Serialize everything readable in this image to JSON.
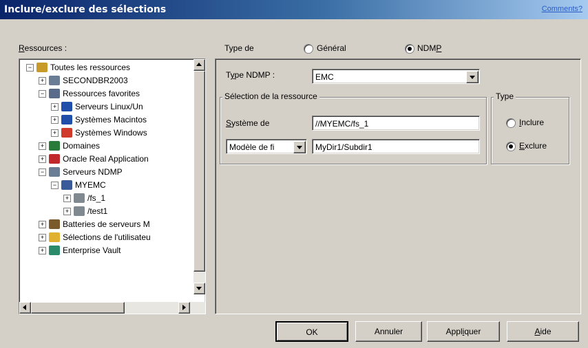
{
  "window": {
    "title": "Inclure/exclure des sélections",
    "comments_link": "Comments?"
  },
  "resources": {
    "label_first": "R",
    "label_rest": "essources :",
    "tree": [
      {
        "label": "Toutes les ressources",
        "icon": "all-resources-icon",
        "expander": "−"
      },
      {
        "label": "SECONDBR2003",
        "icon": "server-icon",
        "expander": "+"
      },
      {
        "label": "Ressources favorites",
        "icon": "favorite-resources-icon",
        "expander": "−"
      },
      {
        "label": "Serveurs Linux/Un",
        "icon": "monitor-icon",
        "expander": "+"
      },
      {
        "label": "Systèmes Macintos",
        "icon": "monitor-icon",
        "expander": "+"
      },
      {
        "label": "Systèmes Windows",
        "icon": "windows-icon",
        "expander": "+"
      },
      {
        "label": "Domaines",
        "icon": "domain-icon",
        "expander": "+"
      },
      {
        "label": "Oracle Real Application",
        "icon": "database-icon",
        "expander": "+"
      },
      {
        "label": "Serveurs NDMP",
        "icon": "server-icon",
        "expander": "−"
      },
      {
        "label": "MYEMC",
        "icon": "tower-icon",
        "expander": "−"
      },
      {
        "label": "/fs_1",
        "icon": "drive-icon",
        "expander": "+"
      },
      {
        "label": "/test1",
        "icon": "drive-icon",
        "expander": "+"
      },
      {
        "label": "Batteries de serveurs M",
        "icon": "server-farm-icon",
        "expander": "+"
      },
      {
        "label": "Sélections de l'utilisateu",
        "icon": "folder-icon",
        "expander": "+"
      },
      {
        "label": "Enterprise Vault",
        "icon": "vault-icon",
        "expander": "+"
      }
    ]
  },
  "type_de": {
    "label": "Type de",
    "options": [
      {
        "label": "Général",
        "selected": false
      },
      {
        "label_main": "NDM",
        "label_ul": "P",
        "selected": true
      }
    ]
  },
  "ndmp": {
    "type_label_pre": "T",
    "type_label_ul": "y",
    "type_label_post": "pe NDMP :",
    "type_value": "EMC",
    "selection_group": "Sélection de la ressource",
    "system_label_ul": "S",
    "system_label_rest": "ystème de",
    "system_value": "//MYEMC/fs_1",
    "pattern_select": "Modèle de fi",
    "pattern_value": "MyDir1/Subdir1",
    "type_group": "Type",
    "include_ul": "I",
    "include_rest": "nclure",
    "exclude_ul": "E",
    "exclude_rest": "xclure",
    "include_selected": false,
    "exclude_selected": true
  },
  "buttons": {
    "ok": "OK",
    "cancel": "Annuler",
    "apply_pre": "Appl",
    "apply_ul": "i",
    "apply_post": "quer",
    "help_ul": "A",
    "help_rest": "ide"
  }
}
